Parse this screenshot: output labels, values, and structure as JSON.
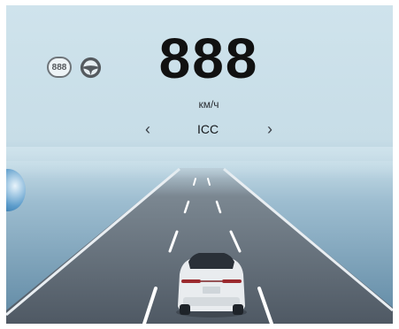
{
  "cluster": {
    "speed_value": "888",
    "speed_unit": "км/ч",
    "speed_limit": "888"
  },
  "adas": {
    "mode_label": "ICC",
    "prev_arrow": "‹",
    "next_arrow": "›"
  },
  "icons": [
    "speed-limit-icon",
    "steering-wheel-icon",
    "chevron-left-icon",
    "chevron-right-icon"
  ],
  "colors": {
    "sky": "#cfe3ec",
    "sea": "#6a93ae",
    "road": "#5d6671",
    "lane_marking": "#ffffff",
    "speed_text": "#111111"
  }
}
